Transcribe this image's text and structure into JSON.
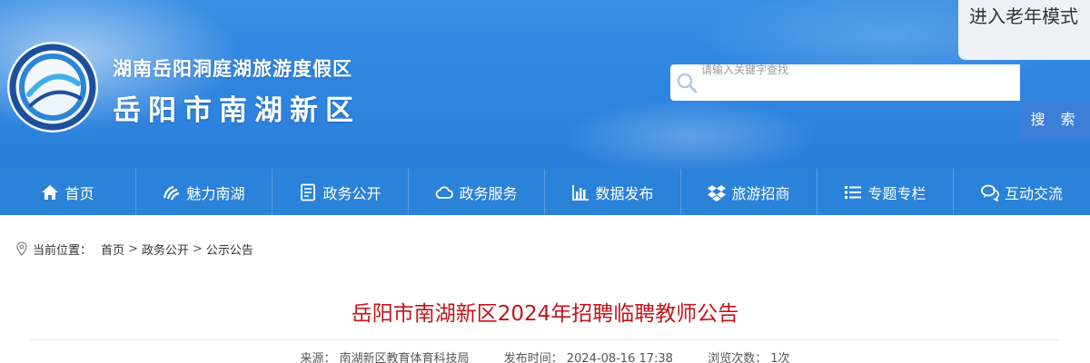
{
  "header": {
    "site_name_line1": "湖南岳阳洞庭湖旅游度假区",
    "site_name_line2": "岳阳市南湖新区",
    "elder_mode_label": "进入老年模式",
    "search_placeholder": "请输入关键字查找",
    "search_button_label": "搜 索"
  },
  "nav": {
    "items": [
      {
        "label": "首页",
        "icon": "home-icon"
      },
      {
        "label": "魅力南湖",
        "icon": "wave-icon"
      },
      {
        "label": "政务公开",
        "icon": "document-icon"
      },
      {
        "label": "政务服务",
        "icon": "cloud-icon"
      },
      {
        "label": "数据发布",
        "icon": "bar-chart-icon"
      },
      {
        "label": "旅游招商",
        "icon": "dropbox-icon"
      },
      {
        "label": "专题专栏",
        "icon": "list-icon"
      },
      {
        "label": "互动交流",
        "icon": "chat-icon"
      }
    ]
  },
  "breadcrumb": {
    "prefix": "当前位置：",
    "items": [
      "首页",
      "政务公开",
      "公示公告"
    ],
    "separator": ">"
  },
  "article": {
    "title": "岳阳市南湖新区2024年招聘临聘教师公告",
    "source_label": "来源：",
    "source": "南湖新区教育体育科技局",
    "published_label": "发布时间：",
    "published": "2024-08-16 17:38",
    "views_label": "浏览次数：",
    "views": "1次"
  },
  "colors": {
    "nav_background": "#2a82d9",
    "title_red": "#c3141a",
    "search_button": "#3d7fd8"
  }
}
